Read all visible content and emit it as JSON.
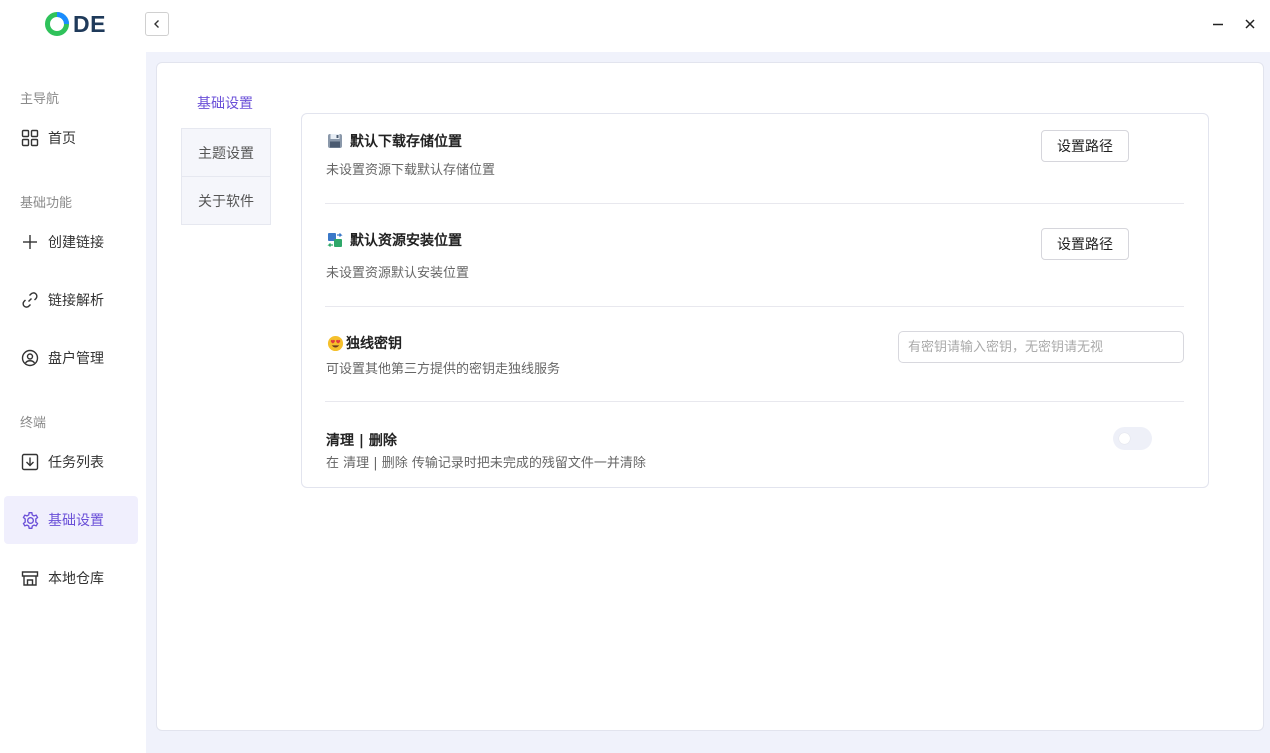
{
  "app": {
    "logo_text": "DE",
    "brand_colors": {
      "ring_green": "#2fc25b",
      "ring_blue": "#1a8cff",
      "text": "#1f3a5a"
    }
  },
  "window_controls": {
    "collapse_icon": "chevron-left-icon",
    "minimize_icon": "minimize-icon",
    "close_icon": "close-icon"
  },
  "sidebar": {
    "groups": [
      {
        "label": "主导航",
        "items": [
          {
            "label": "首页",
            "icon": "grid-icon",
            "active": false
          }
        ]
      },
      {
        "label": "基础功能",
        "items": [
          {
            "label": "创建链接",
            "icon": "plus-icon",
            "active": false
          },
          {
            "label": "链接解析",
            "icon": "link-icon",
            "active": false
          },
          {
            "label": "盘户管理",
            "icon": "user-circle-icon",
            "active": false
          }
        ]
      },
      {
        "label": "终端",
        "items": [
          {
            "label": "任务列表",
            "icon": "download-box-icon",
            "active": false
          },
          {
            "label": "基础设置",
            "icon": "gear-icon",
            "active": true
          },
          {
            "label": "本地仓库",
            "icon": "store-icon",
            "active": false
          }
        ]
      }
    ]
  },
  "tabs": [
    {
      "label": "基础设置",
      "active": true
    },
    {
      "label": "主题设置",
      "active": false
    },
    {
      "label": "关于软件",
      "active": false
    }
  ],
  "settings": {
    "download_location": {
      "icon": "floppy-disk-icon",
      "title": "默认下载存储位置",
      "description": "未设置资源下载默认存储位置",
      "button": "设置路径"
    },
    "install_location": {
      "icon": "transfer-arrows-icon",
      "title": "默认资源安装位置",
      "description": "未设置资源默认安装位置",
      "button": "设置路径"
    },
    "exclusive_key": {
      "icon": "heart-eyes-face-icon",
      "title": "独线密钥",
      "description": "可设置其他第三方提供的密钥走独线服务",
      "input_value": "",
      "input_placeholder": "有密钥请输入密钥，无密钥请无视"
    },
    "cleanup": {
      "title": "清理 | 删除",
      "description": "在 清理 | 删除 传输记录时把未完成的残留文件一并清除",
      "toggle_on": false
    }
  },
  "colors": {
    "accent": "#6a4fd8",
    "active_bg": "#f0effd",
    "main_bg": "#f0f2fb"
  }
}
